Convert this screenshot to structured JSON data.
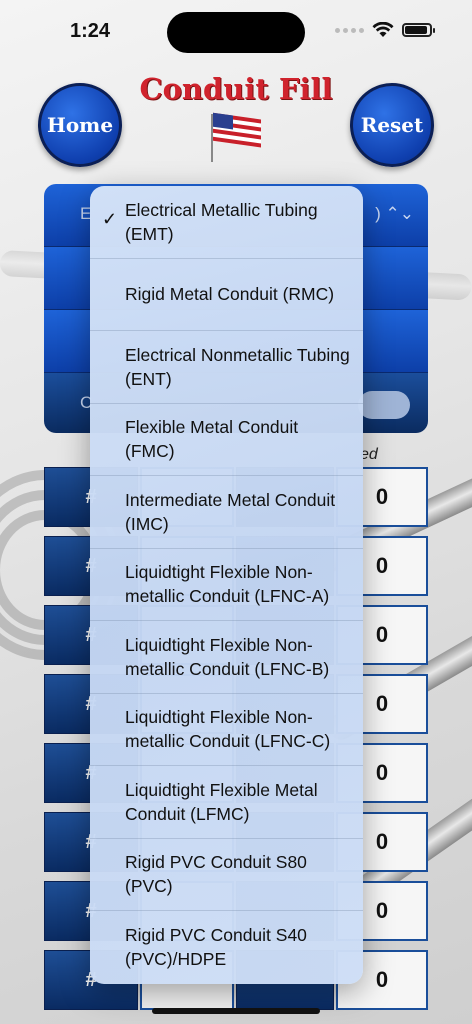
{
  "status": {
    "time": "1:24"
  },
  "title": "Conduit Fill",
  "buttons": {
    "home": "Home",
    "reset": "Reset"
  },
  "panel": {
    "row1_prefix": "E",
    "row1_suffix": ") ⌃⌄",
    "row4_prefix": "C"
  },
  "used_label": "ed",
  "grid": {
    "left_label": "#",
    "rows": [
      {
        "mid": "",
        "right_label": "",
        "value": "0"
      },
      {
        "mid": "",
        "right_label": "",
        "value": "0"
      },
      {
        "mid": "",
        "right_label": "",
        "value": "0"
      },
      {
        "mid": "",
        "right_label": "",
        "value": "0"
      },
      {
        "mid": "",
        "right_label": "",
        "value": "0"
      },
      {
        "mid": "",
        "right_label": "",
        "value": "0"
      },
      {
        "mid": "",
        "right_label": "",
        "value": "0"
      },
      {
        "mid": "",
        "right_label": "",
        "value": "0"
      }
    ]
  },
  "menu": {
    "selected_index": 0,
    "items": [
      "Electrical Metallic Tubing (EMT)",
      "Rigid Metal Conduit (RMC)",
      "Electrical Nonmetallic Tubing (ENT)",
      "Flexible Metal Conduit (FMC)",
      "Intermediate Metal Conduit (IMC)",
      "Liquidtight Flexible Non-metallic Conduit (LFNC-A)",
      "Liquidtight Flexible Non-metallic Conduit (LFNC-B)",
      "Liquidtight Flexible Non-metallic Conduit (LFNC-C)",
      "Liquidtight Flexible Metal Conduit (LFMC)",
      "Rigid PVC Conduit S80 (PVC)",
      "Rigid PVC Conduit S40 (PVC)/HDPE"
    ]
  },
  "colors": {
    "title_red": "#d0232d",
    "button_blue": "#0f3fae",
    "panel_blue": "#0d3fa8"
  },
  "icons": [
    "wifi-icon",
    "battery-icon",
    "checkmark-icon",
    "us-flag-icon",
    "chevron-updown-icon"
  ]
}
